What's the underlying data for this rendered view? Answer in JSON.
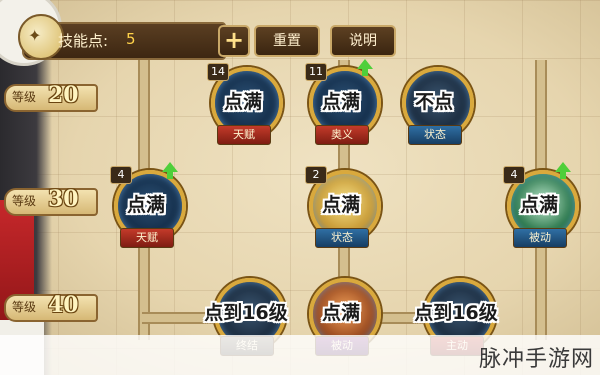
{
  "header": {
    "emblem_text": "✦",
    "skill_points_label": "技能点:",
    "skill_points_value": "5",
    "plus_label": "+",
    "reset_label": "重置",
    "info_label": "说明"
  },
  "levels": [
    {
      "label": "等级",
      "value": "20"
    },
    {
      "label": "等级",
      "value": "30"
    },
    {
      "label": "等级",
      "value": "40"
    }
  ],
  "nodes": [
    {
      "level": "14",
      "status": "点满",
      "type": "天赋",
      "upgrade": false
    },
    {
      "level": "11",
      "status": "点满",
      "type": "奥义",
      "upgrade": true
    },
    {
      "level": "",
      "status": "不点",
      "type": "状态",
      "upgrade": false
    },
    {
      "level": "4",
      "status": "点满",
      "type": "天赋",
      "upgrade": true
    },
    {
      "level": "2",
      "status": "点满",
      "type": "状态",
      "upgrade": false
    },
    {
      "level": "4",
      "status": "点满",
      "type": "被动",
      "upgrade": true
    },
    {
      "level": "",
      "status": "点到16级",
      "type": "终结",
      "upgrade": false
    },
    {
      "level": "",
      "status": "点满",
      "type": "被动",
      "upgrade": false
    },
    {
      "level": "",
      "status": "点到16级",
      "type": "主动",
      "upgrade": false
    }
  ],
  "watermark": "脉冲手游网"
}
